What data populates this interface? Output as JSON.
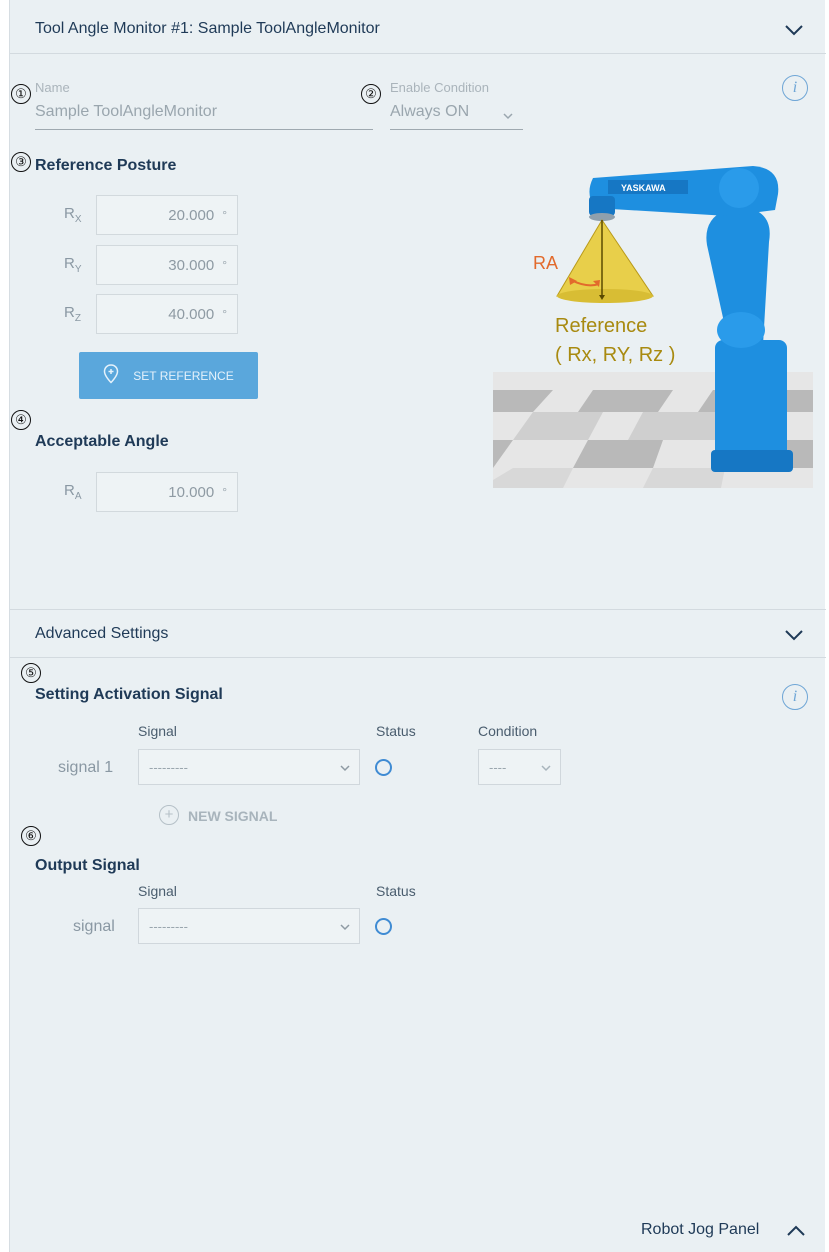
{
  "header": {
    "title": "Tool Angle Monitor #1: Sample ToolAngleMonitor"
  },
  "markers": [
    "①",
    "②",
    "③",
    "④",
    "⑤",
    "⑥"
  ],
  "name_field": {
    "label": "Name",
    "value": "Sample ToolAngleMonitor"
  },
  "enable_condition": {
    "label": "Enable Condition",
    "value": "Always ON"
  },
  "info_icon": "i",
  "reference_posture": {
    "title": "Reference Posture",
    "rows": [
      {
        "axis": "R",
        "sub": "X",
        "value": "20.000",
        "unit": "°"
      },
      {
        "axis": "R",
        "sub": "Y",
        "value": "30.000",
        "unit": "°"
      },
      {
        "axis": "R",
        "sub": "Z",
        "value": "40.000",
        "unit": "°"
      }
    ],
    "set_reference_label": "SET REFERENCE"
  },
  "acceptable_angle": {
    "title": "Acceptable Angle",
    "axis": "R",
    "sub": "A",
    "value": "10.000",
    "unit": "°"
  },
  "illustration": {
    "brand": "YASKAWA",
    "ra_label": "RA",
    "reference_line1": "Reference",
    "reference_line2": "( Rx, RY, Rz )"
  },
  "advanced": {
    "title": "Advanced Settings"
  },
  "activation": {
    "title": "Setting Activation Signal",
    "col_signal": "Signal",
    "col_status": "Status",
    "col_condition": "Condition",
    "row_label": "signal 1",
    "signal_value": "---------",
    "condition_value": "----",
    "new_signal_label": "NEW SIGNAL"
  },
  "output": {
    "title": "Output Signal",
    "col_signal": "Signal",
    "col_status": "Status",
    "row_label": "signal",
    "signal_value": "---------"
  },
  "footer": {
    "jog_panel_label": "Robot Jog Panel"
  },
  "colors": {
    "panel_bg": "#eaf0f3",
    "accent_blue": "#5aa7dc",
    "title_navy": "#1f3a57",
    "robot_blue": "#1e8fe0",
    "cone_yellow": "#e8cf4a",
    "reference_gold": "#a88a10",
    "ra_orange": "#e26a2c"
  }
}
